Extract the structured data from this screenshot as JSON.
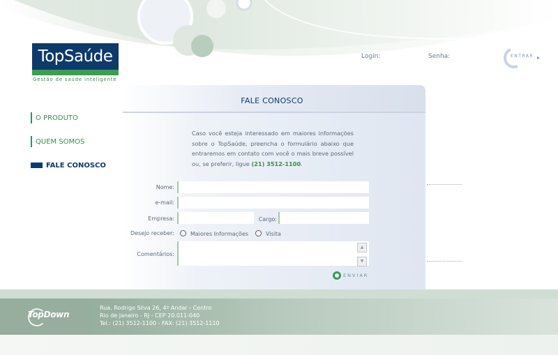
{
  "logo": {
    "name": "TopSaúde",
    "tagline": "Gestão de saúde inteligente"
  },
  "header": {
    "login_label": "Login:",
    "senha_label": "Senha:",
    "entrar_label": "ENTRAR"
  },
  "nav": {
    "items": [
      {
        "label": "O PRODUTO"
      },
      {
        "label": "QUEM SOMOS"
      },
      {
        "label": "FALE CONOSCO"
      }
    ]
  },
  "panel": {
    "title": "FALE CONOSCO",
    "intro_text": "Caso você esteja interessado em maiores informações sobre o TopSaúde, preencha o formulário abaixo que entraremos em contato com você o mais breve possível ou, se preferir, ligue ",
    "intro_phone": "(21) 3512-1100",
    "intro_end": "."
  },
  "form": {
    "nome_label": "Nome:",
    "email_label": "e-mail:",
    "empresa_label": "Empresa:",
    "cargo_label": "Cargo:",
    "desejo_label": "Desejo receber:",
    "option_maiores": "Maiores Informações",
    "option_visita": "Visita",
    "comentarios_label": "Comentários:",
    "enviar_label": "ENVIAR"
  },
  "footer": {
    "brand": "TopDown",
    "address_line1": "Rua. Rodrigo Silva 26, 4º Andar - Centro",
    "address_line2": "Rio de Janeiro - RJ - CEP 20.011-040",
    "address_line3": "Tel.: (21) 3512-1100 - FAX: (21) 3512-1110"
  },
  "colors": {
    "brand_blue": "#0d3a6a",
    "brand_green": "#3aa14a",
    "footer_green": "#8ea896"
  }
}
